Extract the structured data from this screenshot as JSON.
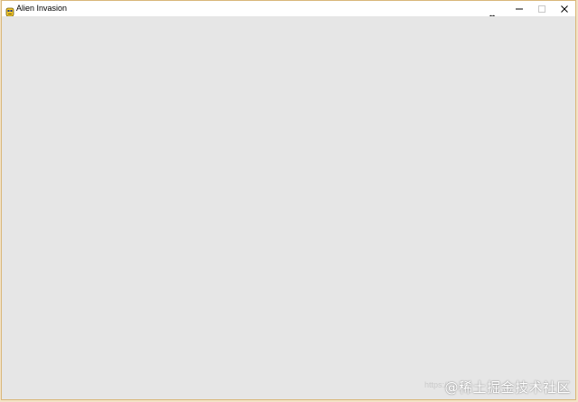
{
  "window": {
    "title": "Alien Invasion",
    "icon": "pygame-snake-icon",
    "controls": {
      "minimize": "minimize-icon",
      "maximize": "maximize-icon",
      "close": "close-icon"
    }
  },
  "content": {
    "background": "#e6e6e6"
  },
  "watermark": {
    "url_text": "https://",
    "text": "@稀土掘金技术社区"
  }
}
